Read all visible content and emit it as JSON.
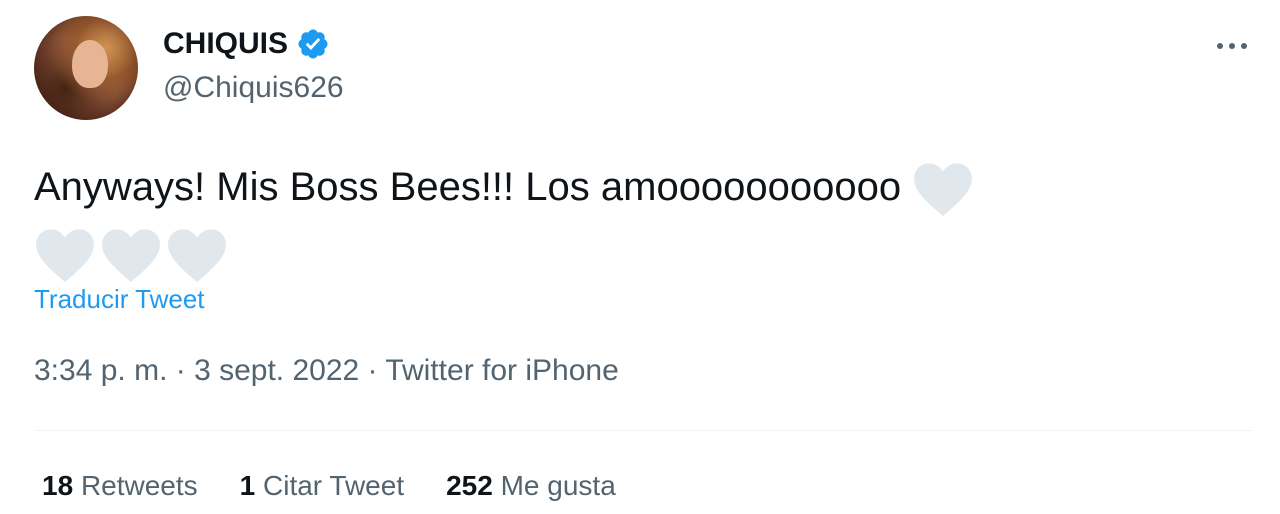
{
  "author": {
    "display_name": "CHIQUIS",
    "handle": "@Chiquis626",
    "verified_icon": "verified-badge-icon",
    "avatar_icon": "profile-photo"
  },
  "menu": {
    "icon": "more-options-icon"
  },
  "tweet": {
    "text_part1": "Anyways! Mis Boss Bees!!! Los amooooooooooo",
    "hearts": [
      "white-heart-emoji",
      "white-heart-emoji",
      "white-heart-emoji",
      "white-heart-emoji"
    ],
    "translate_label": "Traducir Tweet"
  },
  "meta": {
    "time": "3:34 p. m.",
    "sep1": " · ",
    "date": "3 sept. 2022",
    "sep2": " · ",
    "source": "Twitter for iPhone"
  },
  "stats": {
    "retweets_count": "18",
    "retweets_label": "Retweets",
    "quotes_count": "1",
    "quotes_label": "Citar Tweet",
    "likes_count": "252",
    "likes_label": "Me gusta"
  },
  "colors": {
    "link": "#1d9bf0",
    "secondary_text": "#536471",
    "primary_text": "#0f1419",
    "heart_fill": "#e1e8ed"
  }
}
